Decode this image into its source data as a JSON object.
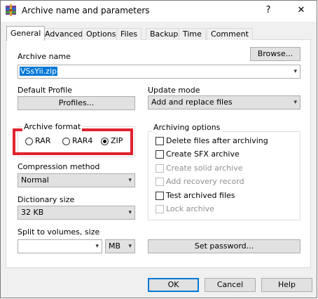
{
  "window": {
    "title": "Archive name and parameters",
    "help_glyph": "?",
    "close_glyph": "✕",
    "icon": "winrar-archive-icon"
  },
  "tabs": [
    {
      "label": "General",
      "active": true
    },
    {
      "label": "Advanced",
      "active": false
    },
    {
      "label": "Options",
      "active": false
    },
    {
      "label": "Files",
      "active": false
    },
    {
      "label": "Backup",
      "active": false
    },
    {
      "label": "Time",
      "active": false
    },
    {
      "label": "Comment",
      "active": false
    }
  ],
  "archive_name": {
    "label": "Archive name",
    "value": "VSsYii.zip",
    "browse_label": "Browse..."
  },
  "default_profile": {
    "label": "Default Profile",
    "button_label": "Profiles..."
  },
  "update_mode": {
    "label": "Update mode",
    "value": "Add and replace files"
  },
  "archive_format": {
    "label": "Archive format",
    "options": [
      {
        "label": "RAR",
        "selected": false
      },
      {
        "label": "RAR4",
        "selected": false
      },
      {
        "label": "ZIP",
        "selected": true
      }
    ],
    "highlight_color": "#e0222e"
  },
  "compression_method": {
    "label": "Compression method",
    "value": "Normal"
  },
  "dictionary_size": {
    "label": "Dictionary size",
    "value": "32 KB"
  },
  "split_volumes": {
    "label": "Split to volumes, size",
    "value": "",
    "unit": "MB"
  },
  "archiving_options": {
    "label": "Archiving options",
    "items": [
      {
        "label": "Delete files after archiving",
        "checked": false,
        "enabled": true
      },
      {
        "label": "Create SFX archive",
        "checked": false,
        "enabled": true
      },
      {
        "label": "Create solid archive",
        "checked": false,
        "enabled": false
      },
      {
        "label": "Add recovery record",
        "checked": false,
        "enabled": false
      },
      {
        "label": "Test archived files",
        "checked": false,
        "enabled": true
      },
      {
        "label": "Lock archive",
        "checked": false,
        "enabled": false
      }
    ]
  },
  "set_password_label": "Set password...",
  "footer": {
    "ok": "OK",
    "cancel": "Cancel",
    "help": "Help"
  },
  "colors": {
    "accent": "#0078d7",
    "highlight": "#e0222e",
    "disabled_text": "#8f8f8f"
  }
}
